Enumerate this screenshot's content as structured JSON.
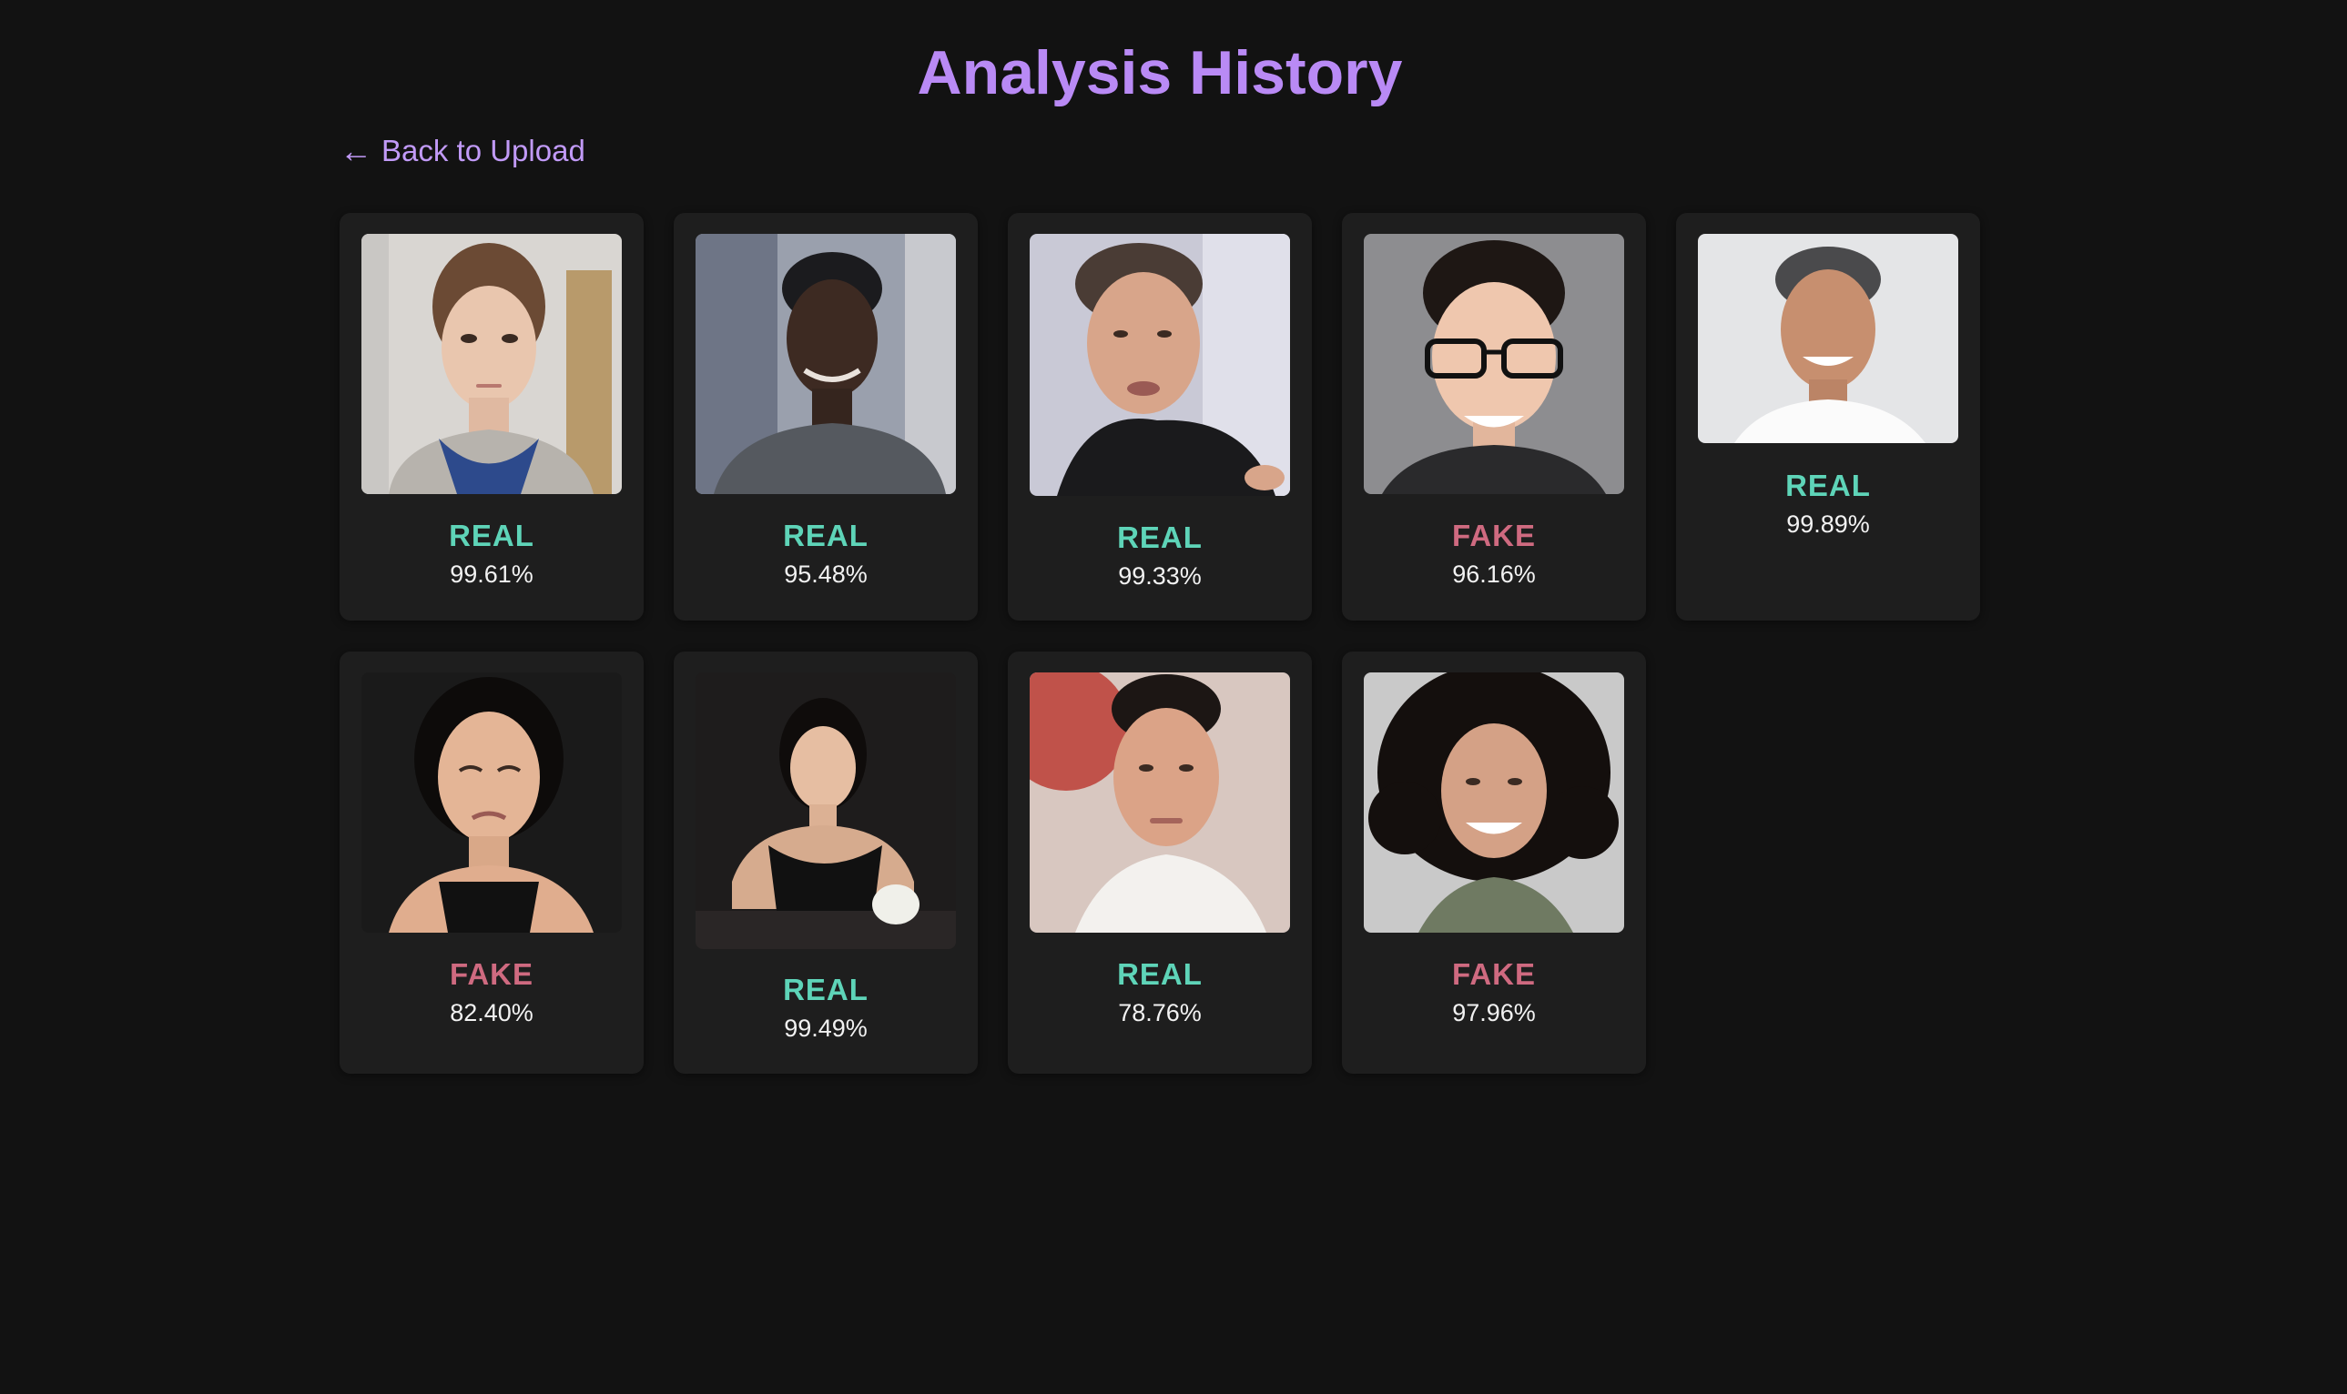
{
  "header": {
    "title": "Analysis History",
    "back_link": {
      "arrow": "←",
      "label": "Back to Upload"
    }
  },
  "results": [
    {
      "label": "REAL",
      "confidence": "99.61%",
      "verdict": "real"
    },
    {
      "label": "REAL",
      "confidence": "95.48%",
      "verdict": "real"
    },
    {
      "label": "REAL",
      "confidence": "99.33%",
      "verdict": "real"
    },
    {
      "label": "FAKE",
      "confidence": "96.16%",
      "verdict": "fake"
    },
    {
      "label": "REAL",
      "confidence": "99.89%",
      "verdict": "real"
    },
    {
      "label": "FAKE",
      "confidence": "82.40%",
      "verdict": "fake"
    },
    {
      "label": "REAL",
      "confidence": "99.49%",
      "verdict": "real"
    },
    {
      "label": "REAL",
      "confidence": "78.76%",
      "verdict": "real"
    },
    {
      "label": "FAKE",
      "confidence": "97.96%",
      "verdict": "fake"
    }
  ],
  "colors": {
    "title": "#b98af5",
    "real": "#5ed4b8",
    "fake": "#cf6a80",
    "background": "#121212",
    "card": "#1e1e1e"
  }
}
